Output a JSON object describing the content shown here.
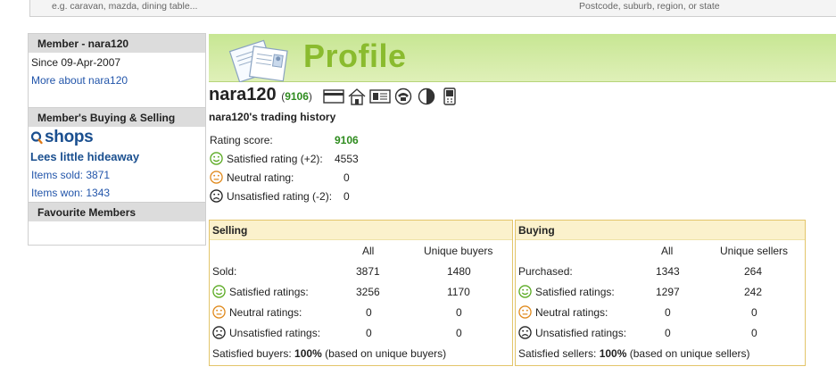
{
  "search": {
    "keyword_placeholder": "e.g. caravan, mazda, dining table...",
    "location_placeholder": "Postcode, suburb, region, or state"
  },
  "sidebar": {
    "member_heading": "Member - nara120",
    "since": "Since 09-Apr-2007",
    "more_about": "More about nara120",
    "buying_selling_heading": "Member's Buying & Selling",
    "shops_logo": "shops",
    "store_name": "Lees little hideaway",
    "items_sold": "Items sold: 3871",
    "items_won": "Items won: 1343",
    "favourites_heading": "Favourite Members"
  },
  "banner": {
    "title": "Profile"
  },
  "profile": {
    "username": "nara120",
    "score_open": "(",
    "score": "9106",
    "score_close": ")",
    "icons": [
      "credit-card-icon",
      "home-icon",
      "id-card-icon",
      "phone-icon",
      "half-circle-icon",
      "mobile-icon"
    ],
    "history_title": "nara120's trading history"
  },
  "ratings": [
    {
      "label": "Rating score:",
      "value": "9106",
      "face": ""
    },
    {
      "label": "Satisfied rating (+2):",
      "value": "4553",
      "face": "happy"
    },
    {
      "label": "Neutral rating:",
      "value": "0",
      "face": "neutral"
    },
    {
      "label": "Unsatisfied rating (-2):",
      "value": "0",
      "face": "sad"
    }
  ],
  "selling": {
    "heading": "Selling",
    "col_all": "All",
    "col_unique": "Unique buyers",
    "rows": [
      {
        "label": "Sold:",
        "all": "3871",
        "unique": "1480",
        "face": ""
      },
      {
        "label": "Satisfied ratings:",
        "all": "3256",
        "unique": "1170",
        "face": "happy"
      },
      {
        "label": "Neutral ratings:",
        "all": "0",
        "unique": "0",
        "face": "neutral"
      },
      {
        "label": "Unsatisfied ratings:",
        "all": "0",
        "unique": "0",
        "face": "sad"
      }
    ],
    "footer_prefix": "Satisfied buyers: ",
    "footer_pct": "100%",
    "footer_suffix": " (based on unique buyers)"
  },
  "buying": {
    "heading": "Buying",
    "col_all": "All",
    "col_unique": "Unique sellers",
    "rows": [
      {
        "label": "Purchased:",
        "all": "1343",
        "unique": "264",
        "face": ""
      },
      {
        "label": "Satisfied ratings:",
        "all": "1297",
        "unique": "242",
        "face": "happy"
      },
      {
        "label": "Neutral ratings:",
        "all": "0",
        "unique": "0",
        "face": "neutral"
      },
      {
        "label": "Unsatisfied ratings:",
        "all": "0",
        "unique": "0",
        "face": "sad"
      }
    ],
    "footer_prefix": "Satisfied sellers: ",
    "footer_pct": "100%",
    "footer_suffix": " (based on unique sellers)"
  },
  "colors": {
    "accent_green": "#8abb2e",
    "score_green": "#2e8b1e",
    "link_blue": "#2255aa",
    "panel_border": "#e3c56a"
  }
}
